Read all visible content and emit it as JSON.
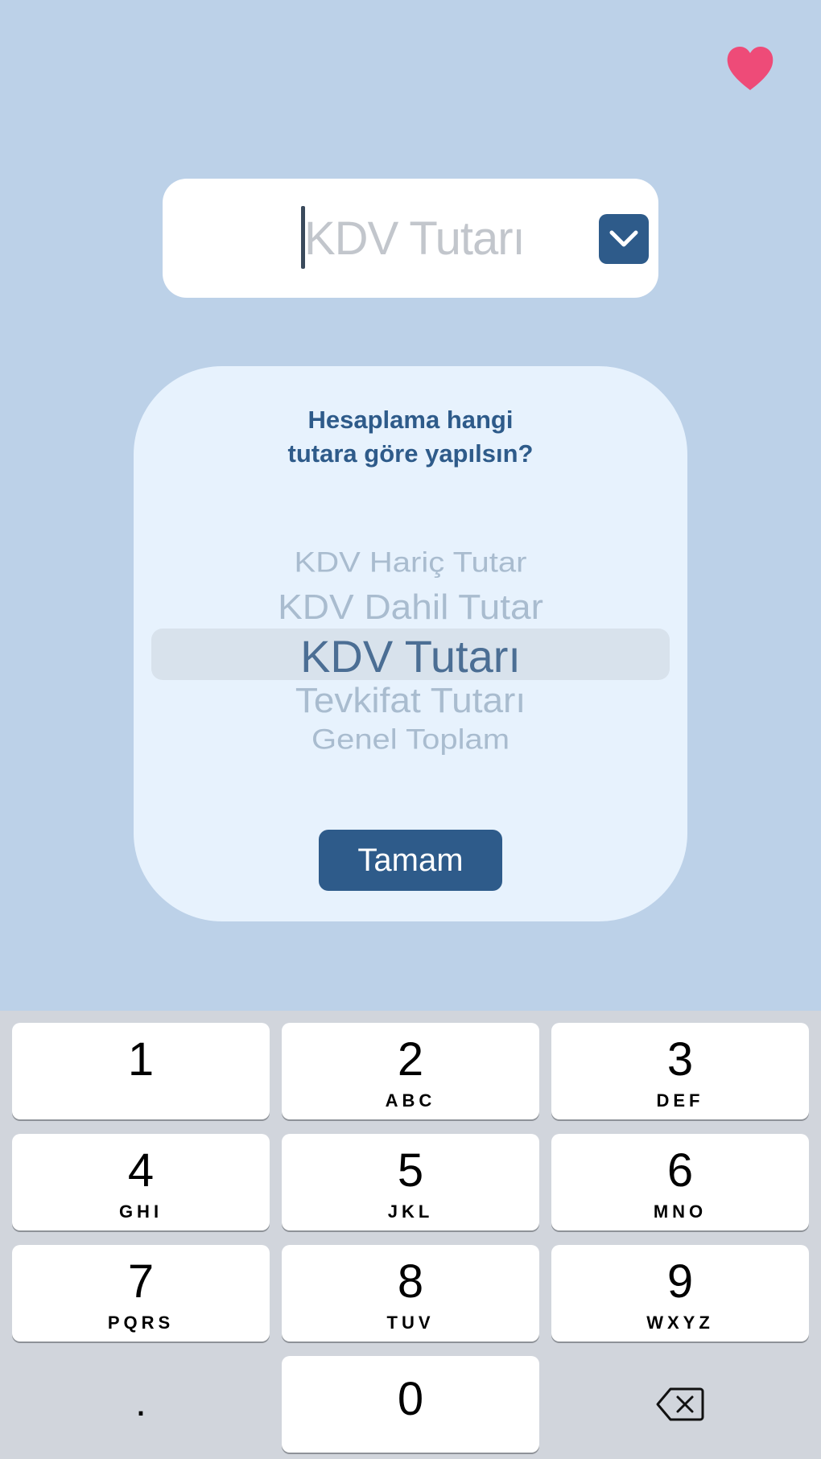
{
  "favorite": {
    "icon": "heart-icon",
    "color": "#ee4b78"
  },
  "amount_field": {
    "placeholder": "KDV Tutarı",
    "value": "",
    "dropdown_icon": "chevron-down-icon"
  },
  "modal": {
    "question_line1": "Hesaplama hangi",
    "question_line2": "tutara göre yapılsın?",
    "options": [
      "KDV Hariç Tutar",
      "KDV Dahil Tutar",
      "KDV Tutarı",
      "Tevkifat Tutarı",
      "Genel Toplam"
    ],
    "selected_option": "KDV Tutarı",
    "ok_label": "Tamam"
  },
  "keypad": {
    "keys": [
      {
        "digit": "1",
        "letters": ""
      },
      {
        "digit": "2",
        "letters": "ABC"
      },
      {
        "digit": "3",
        "letters": "DEF"
      },
      {
        "digit": "4",
        "letters": "GHI"
      },
      {
        "digit": "5",
        "letters": "JKL"
      },
      {
        "digit": "6",
        "letters": "MNO"
      },
      {
        "digit": "7",
        "letters": "PQRS"
      },
      {
        "digit": "8",
        "letters": "TUV"
      },
      {
        "digit": "9",
        "letters": "WXYZ"
      },
      {
        "digit": "0",
        "letters": ""
      }
    ],
    "decimal_label": ".",
    "delete_icon": "backspace-icon"
  },
  "colors": {
    "background": "#bcd1e8",
    "accent": "#2e5b8a",
    "modal_bg": "#e7f2fd"
  }
}
